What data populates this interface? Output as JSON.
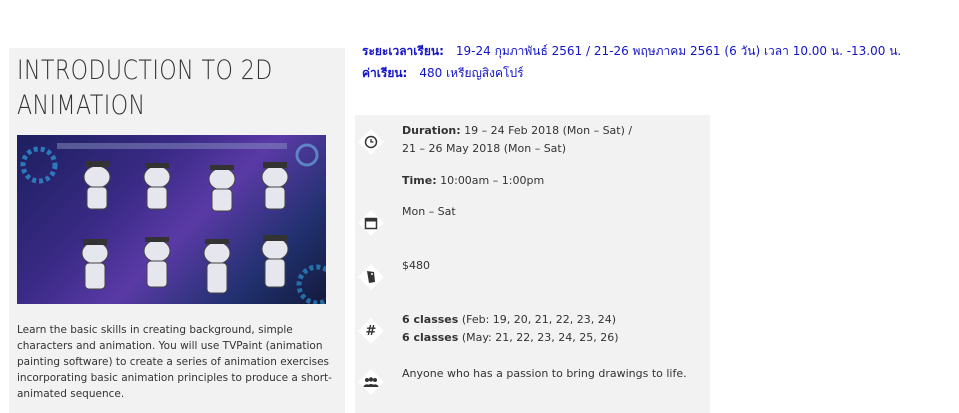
{
  "course": {
    "title_line1": "INTRODUCTION TO 2D",
    "title_line2": "ANIMATION",
    "description": "Learn the basic skills in creating background, simple characters and animation. You will use TVPaint (animation painting software) to create a series of animation exercises incorporating basic animation principles to produce a short-animated sequence."
  },
  "thai_info": {
    "period_label": "ระยะเวลาเรียน:",
    "period_value": "19-24 กุมภาพันธ์ 2561 / 21-26 พฤษภาคม 2561  (6 วัน) เวลา 10.00 น. -13.00 น.",
    "fee_label": "ค่าเรียน:",
    "fee_value": "480 เหรียญสิงคโปร์"
  },
  "details": {
    "duration_label": "Duration:",
    "duration_value_1": "19 – 24 Feb 2018 (Mon – Sat) /",
    "duration_value_2": "21 – 26 May 2018 (Mon – Sat)",
    "time_label": "Time:",
    "time_value": "10:00am – 1:00pm",
    "days": "Mon – Sat",
    "price": "$480",
    "classes_1_label": "6 classes",
    "classes_1_value": "(Feb: 19, 20, 21, 22, 23, 24)",
    "classes_2_label": "6 classes",
    "classes_2_value": "(May: 21, 22, 23, 24, 25, 26)",
    "audience": "Anyone who has a passion to bring drawings to life."
  },
  "icons": {
    "duration": "clock-icon",
    "days": "calendar-icon",
    "price": "price-tag-icon",
    "classes": "hash-icon",
    "audience": "people-icon"
  },
  "colors": {
    "thai_text": "#1414c8",
    "card_bg": "#f2f2f2",
    "body_text": "#333333"
  }
}
